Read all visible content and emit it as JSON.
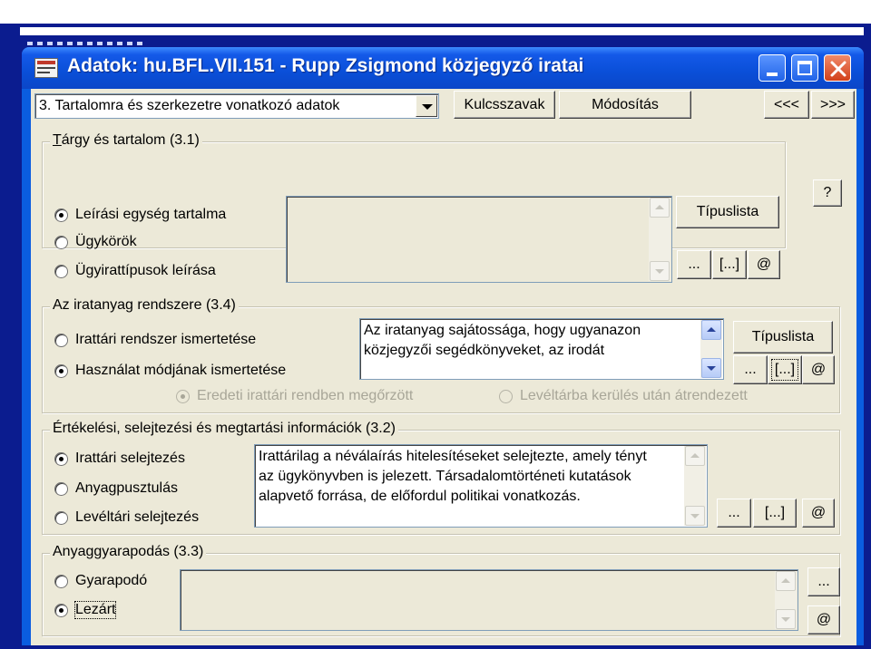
{
  "window": {
    "title": "Adatok: hu.BFL.VII.151 - Rupp Zsigmond közjegyző iratai"
  },
  "toolbar": {
    "section_select": "3. Tartalomra és szerkezetre vonatkozó adatok",
    "keywords_label": "Kulcsszavak",
    "modify_label": "Módosítás",
    "prev_label": "<<<",
    "next_label": ">>>",
    "help_label": "?"
  },
  "common_buttons": {
    "dots": "...",
    "bracket_dots": "[...]",
    "at": "@"
  },
  "groups": {
    "subject": {
      "legend": "Tárgy és tartalom (3.1)",
      "options": [
        {
          "label": "Leírási egység tartalma",
          "checked": true
        },
        {
          "label": "Ügykörök",
          "checked": false
        },
        {
          "label": "Ügyirattípusok leírása",
          "checked": false
        }
      ],
      "text": "",
      "typelist_label": "Típuslista"
    },
    "system": {
      "legend": "Az iratanyag rendszere (3.4)",
      "options": [
        {
          "label": "Irattári rendszer ismertetése",
          "checked": false
        },
        {
          "label": "Használat módjának ismertetése",
          "checked": true
        }
      ],
      "text": "Az iratanyag sajátossága, hogy ugyanazon\nközjegyzői segédkönyveket, az irodát",
      "typelist_label": "Típuslista",
      "sub_options": [
        {
          "label": "Eredeti irattári rendben megőrzött",
          "checked": true,
          "enabled": false
        },
        {
          "label": "Levéltárba kerülés után átrendezett",
          "checked": false,
          "enabled": false
        }
      ]
    },
    "appraisal": {
      "legend": "Értékelési, selejtezési és megtartási információk (3.2)",
      "options": [
        {
          "label": "Irattári selejtezés",
          "checked": true
        },
        {
          "label": "Anyagpusztulás",
          "checked": false
        },
        {
          "label": "Levéltári selejtezés",
          "checked": false
        }
      ],
      "text": "Irattárilag a néválaírás hitelesítéseket selejtezte, amely tényt\naz ügykönyvben is jelezett. Társadalomtörténeti kutatások\nalapvető forrása, de előfordul politikai vonatkozás."
    },
    "accrual": {
      "legend": "Anyaggyarapodás (3.3)",
      "options": [
        {
          "label": "Gyarapodó",
          "checked": false
        },
        {
          "label": "Lezárt",
          "checked": true
        }
      ],
      "text": ""
    }
  }
}
